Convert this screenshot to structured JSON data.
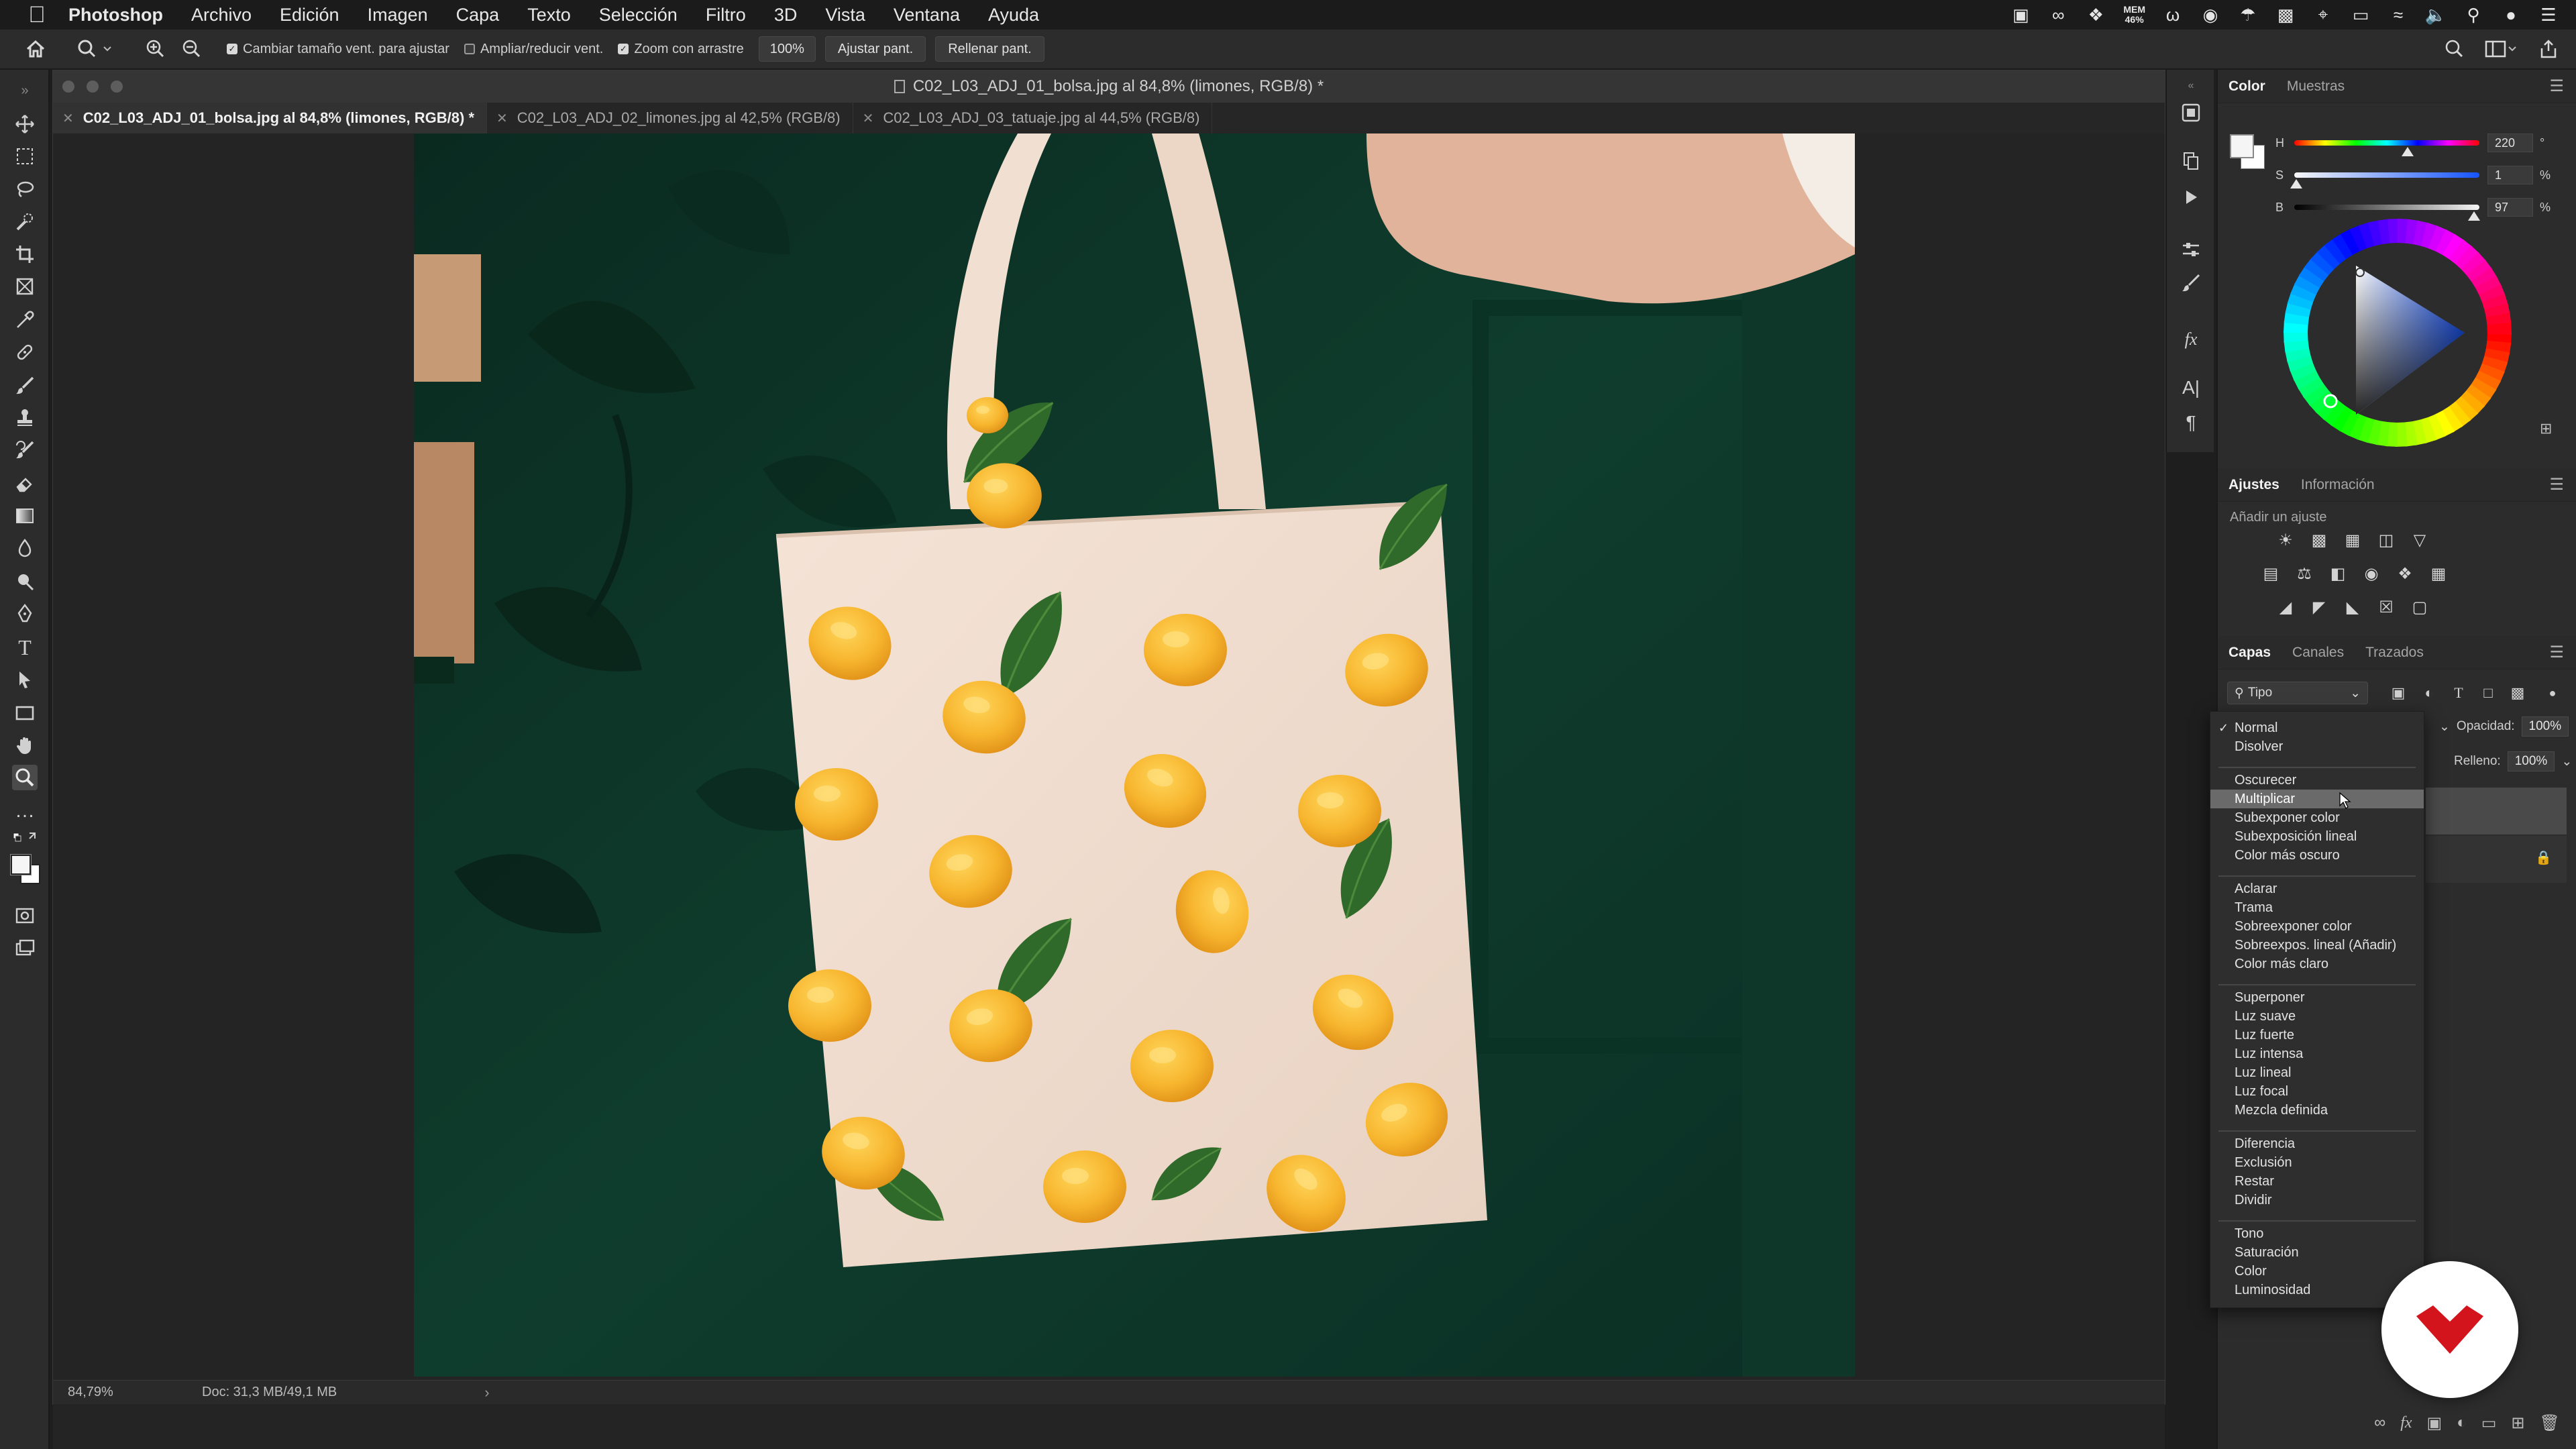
{
  "menubar": {
    "app": "Photoshop",
    "items": [
      "Archivo",
      "Edición",
      "Imagen",
      "Capa",
      "Texto",
      "Selección",
      "Filtro",
      "3D",
      "Vista",
      "Ventana",
      "Ayuda"
    ],
    "mem_label": "MEM",
    "mem_value": "46%"
  },
  "options": {
    "resize_windows": "Cambiar tamaño vent. para ajustar",
    "zoom_all": "Ampliar/reducir vent.",
    "scrubby_zoom": "Zoom con arrastre",
    "zoom_value": "100%",
    "fit_screen": "Ajustar pant.",
    "fill_screen": "Rellenar pant."
  },
  "document": {
    "title": "C02_L03_ADJ_01_bolsa.jpg al 84,8% (limones, RGB/8) *",
    "tabs": [
      {
        "label": "C02_L03_ADJ_01_bolsa.jpg al 84,8% (limones, RGB/8) *",
        "active": true
      },
      {
        "label": "C02_L03_ADJ_02_limones.jpg al 42,5% (RGB/8)",
        "active": false
      },
      {
        "label": "C02_L03_ADJ_03_tatuaje.jpg al 44,5% (RGB/8)",
        "active": false
      }
    ],
    "status_zoom": "84,79%",
    "status_doc": "Doc: 31,3 MB/49,1 MB"
  },
  "color_panel": {
    "tabs": [
      "Color",
      "Muestras"
    ],
    "h_label": "H",
    "h_value": "220",
    "h_unit": "°",
    "s_label": "S",
    "s_value": "1",
    "s_unit": "%",
    "b_label": "B",
    "b_value": "97",
    "b_unit": "%",
    "h_fraction": 0.611,
    "s_fraction": 0.01,
    "b_fraction": 0.97
  },
  "adjust_panel": {
    "tabs": [
      "Ajustes",
      "Información"
    ],
    "hint": "Añadir un ajuste"
  },
  "layers_panel": {
    "tabs": [
      "Capas",
      "Canales",
      "Trazados"
    ],
    "filter": "Tipo",
    "opacity_label": "Opacidad:",
    "opacity_value": "100%",
    "fill_label": "Relleno:",
    "fill_value": "100%"
  },
  "blend_menu": {
    "groups": [
      [
        "Normal",
        "Disolver"
      ],
      [
        "Oscurecer",
        "Multiplicar",
        "Subexponer color",
        "Subexposición lineal",
        "Color más oscuro"
      ],
      [
        "Aclarar",
        "Trama",
        "Sobreexponer color",
        "Sobreexpos. lineal (Añadir)",
        "Color más claro"
      ],
      [
        "Superponer",
        "Luz suave",
        "Luz fuerte",
        "Luz intensa",
        "Luz lineal",
        "Luz focal",
        "Mezcla definida"
      ],
      [
        "Diferencia",
        "Exclusión",
        "Restar",
        "Dividir"
      ],
      [
        "Tono",
        "Saturación",
        "Color",
        "Luminosidad"
      ]
    ],
    "checked": "Normal",
    "highlighted": "Multiplicar"
  },
  "colors": {
    "fg": "#f5f5f5",
    "bg": "#ffffff",
    "wall": "#0f3a2c",
    "badge": "#d4141c"
  }
}
